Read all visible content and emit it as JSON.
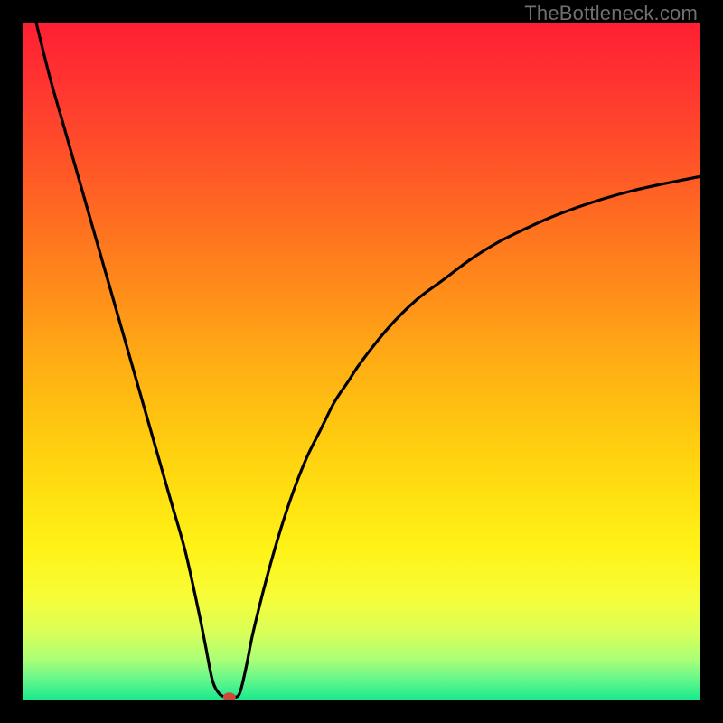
{
  "watermark": "TheBottleneck.com",
  "chart_data": {
    "type": "line",
    "title": "",
    "xlabel": "",
    "ylabel": "",
    "xlim": [
      0,
      100
    ],
    "ylim": [
      0,
      100
    ],
    "grid": false,
    "legend": false,
    "series": [
      {
        "name": "bottleneck-curve",
        "x": [
          0,
          2,
          4,
          6,
          8,
          10,
          12,
          14,
          16,
          18,
          20,
          22,
          24,
          26,
          27,
          28,
          29,
          30,
          31,
          32,
          33,
          34,
          36,
          38,
          40,
          42,
          44,
          46,
          48,
          50,
          54,
          58,
          62,
          66,
          70,
          74,
          78,
          82,
          86,
          90,
          94,
          98,
          100
        ],
        "y": [
          108,
          100,
          92,
          85,
          78,
          71,
          64,
          57,
          50,
          43,
          36,
          29,
          22,
          13,
          8,
          3,
          1,
          0.5,
          0.5,
          1,
          5,
          10,
          18,
          25,
          31,
          36,
          40,
          44,
          47,
          50,
          55,
          59,
          62,
          65,
          67.5,
          69.5,
          71.3,
          72.8,
          74.1,
          75.2,
          76.1,
          76.9,
          77.3
        ]
      }
    ],
    "marker": {
      "x": 30.5,
      "y": 0.5,
      "color": "#cc4a3a",
      "rx": 7,
      "ry": 5
    },
    "gradient_stops": [
      {
        "offset": 0.0,
        "color": "#ff1f33"
      },
      {
        "offset": 0.1,
        "color": "#ff3730"
      },
      {
        "offset": 0.2,
        "color": "#ff5228"
      },
      {
        "offset": 0.3,
        "color": "#ff7020"
      },
      {
        "offset": 0.4,
        "color": "#ff8e1a"
      },
      {
        "offset": 0.5,
        "color": "#ffad14"
      },
      {
        "offset": 0.6,
        "color": "#ffc810"
      },
      {
        "offset": 0.7,
        "color": "#ffe111"
      },
      {
        "offset": 0.78,
        "color": "#fff318"
      },
      {
        "offset": 0.85,
        "color": "#f6fd3a"
      },
      {
        "offset": 0.9,
        "color": "#d9ff58"
      },
      {
        "offset": 0.94,
        "color": "#aaff77"
      },
      {
        "offset": 0.97,
        "color": "#63f78b"
      },
      {
        "offset": 1.0,
        "color": "#17e98d"
      }
    ]
  }
}
